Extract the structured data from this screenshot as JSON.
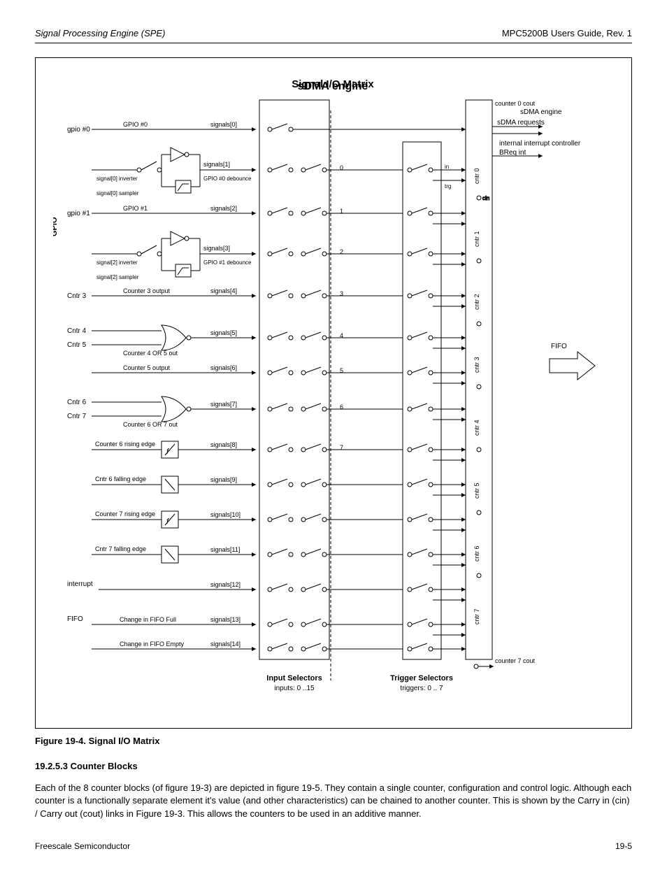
{
  "header": {
    "left": "Signal Processing Engine (SPE)",
    "right": "MPC5200B Users Guide, Rev. 1"
  },
  "figure": {
    "title": "Signal I/O Matrix",
    "caption": "Figure 19-4. Signal I/O Matrix",
    "labels": {
      "sdma_eng": "sDMA engine",
      "int_ctrl": "internal interrupt controller",
      "fifo": "FIFO",
      "input_section": "Input Selectors",
      "trigger_section": "Trigger Selectors",
      "inputs_0_15": "inputs: 0 ..15",
      "triggers_0_7": "triggers: 0 .. 7",
      "trigger_idx": [
        "0",
        "1",
        "2",
        "3",
        "4",
        "5",
        "6",
        "7"
      ],
      "extra_labels": [
        "0",
        "1",
        "2",
        "3",
        "4"
      ],
      "signal_labels": {
        "s0": "signals[0]",
        "s1": "signals[1]",
        "s2": "signals[2]",
        "s3": "signals[3]",
        "s4": "signals[4]",
        "s5": "signals[5]",
        "s6": "signals[6]",
        "s7": "signals[7]",
        "s8": "signals[8]",
        "s9": "signals[9]",
        "s10": "signals[10]",
        "s11": "signals[11]",
        "s12": "signals[12]",
        "s13": "signals[13]",
        "s14": "signals[14]"
      },
      "desc": {
        "d0": "GPIO #0",
        "d1": "GPIO #0 debounce",
        "d2": "GPIO #1",
        "d3": "GPIO #1 debounce",
        "d4": "Counter 3 output",
        "d5": "Counter 4 OR 5 out",
        "d6": "Counter 5 output",
        "d7": "Counter 6 OR 7 out",
        "d8": "Counter 6 rising edge",
        "d9": "Cntr 6 falling edge",
        "d10": "Counter 7 rising edge",
        "d11": "Cntr 7 falling edge",
        "d12": "Change in FIFO Full",
        "d13": "Change in FIFO Empty"
      },
      "inv0": "signal[0] inverter",
      "inv1": "signal[2] inverter",
      "smpl0": "signal[0] sampler",
      "smpl1": "signal[2] sampler",
      "gpio": "GPIO",
      "gpio0": "gpio #0",
      "gpio1": "gpio #1",
      "cntr3": "Cntr 3",
      "cntr4": "Cntr 4",
      "cntr5": "Cntr 5",
      "cntr6": "Cntr 6",
      "cntr7": "Cntr 7",
      "interrupt": "interrupt",
      "out_sdma0": "sDMA requests",
      "out_int_breq": "BReq int",
      "counters": [
        "cntr 0",
        "cntr 1",
        "cntr 2",
        "cntr 3",
        "cntr 4",
        "cntr 5",
        "cntr 6",
        "cntr 7"
      ],
      "in": "in",
      "trg": "trg",
      "cin": "cin",
      "counter0_cout": "counter 0 cout",
      "counter7_cout": "counter 7 cout"
    }
  },
  "paragraph": {
    "p1": "19.2.5.3  Counter Blocks",
    "p2": "Each of the 8 counter blocks (of figure 19-3) are depicted in figure 19-5. They contain a single counter, configuration and control logic. Although each counter is a functionally separate element it's value (and other characteristics) can be chained to another counter. This is shown by the Carry in (cin) / Carry out (cout) links in Figure 19-3. This allows the counters to be used in an additive manner."
  },
  "pagenum": "19-5",
  "footer": "Freescale Semiconductor"
}
